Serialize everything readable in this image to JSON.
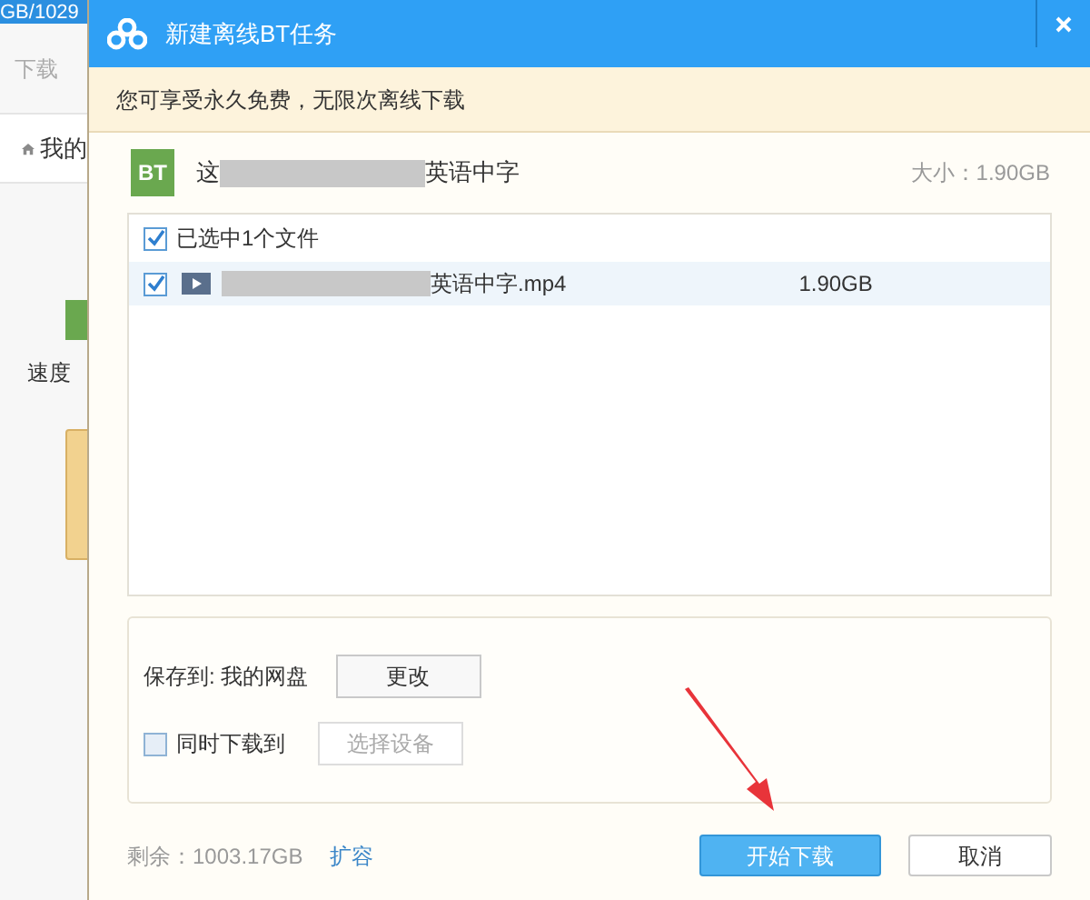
{
  "background_app": {
    "storage": "GB/1029",
    "tab": "下载",
    "breadcrumb": "我的",
    "card_label": "速度"
  },
  "dialog": {
    "title": "新建离线BT任务",
    "notice": "您可享受永久免费，无限次离线下载",
    "torrent": {
      "icon_text": "BT",
      "name_prefix": "这",
      "name_suffix": "英语中字",
      "size": "大小：1.90GB"
    },
    "file_list": {
      "select_all": {
        "label": "已选中1个文件",
        "checked": true
      },
      "files": [
        {
          "name_suffix": "英语中字.mp4",
          "size": "1.90GB",
          "checked": true
        }
      ]
    },
    "save": {
      "label": "保存到: 我的网盘",
      "change_button": "更改"
    },
    "sync": {
      "label": "同时下载到",
      "checked": false,
      "device_button": "选择设备"
    },
    "quota": {
      "remaining": "剩余：1003.17GB",
      "expand_link": "扩容"
    },
    "buttons": {
      "start": "开始下载",
      "cancel": "取消"
    }
  }
}
